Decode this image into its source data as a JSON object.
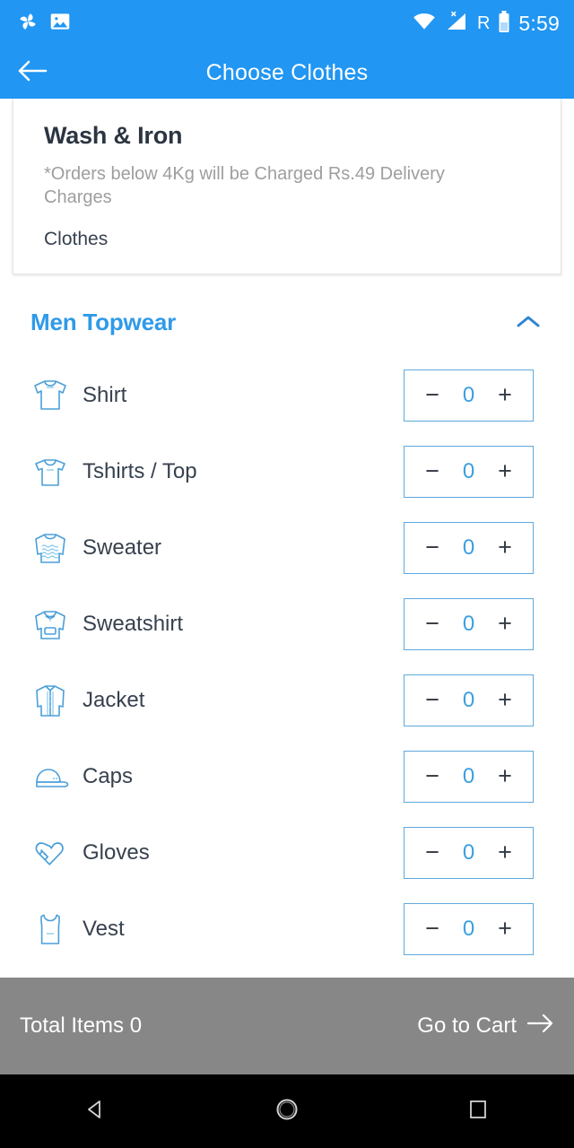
{
  "statusbar": {
    "notif_icons": [
      "photos-pinwheel-icon",
      "gallery-image-icon"
    ],
    "wifi_icon": "wifi-icon",
    "signal_icon": "cell-signal-no-sim-icon",
    "roaming_label": "R",
    "battery_icon": "battery-icon",
    "time": "5:59",
    "background": "#2196f3"
  },
  "appbar": {
    "back_icon": "arrow-left-icon",
    "title": "Choose Clothes",
    "background": "#2196f3"
  },
  "info_card": {
    "title": "Wash & Iron",
    "note": "*Orders below 4Kg will be Charged Rs.49 Delivery Charges",
    "subtitle": "Clothes"
  },
  "section": {
    "title": "Men Topwear",
    "title_color": "#2f9ae8",
    "collapse_icon": "chevron-up-icon",
    "expanded": true
  },
  "stepper": {
    "minus_label": "−",
    "plus_label": "+",
    "border_color": "#5fa9dd",
    "value_color": "#3b9fe0"
  },
  "items": [
    {
      "label": "Shirt",
      "icon": "shirt-icon",
      "qty": "0"
    },
    {
      "label": "Tshirts / Top",
      "icon": "tshirt-icon",
      "qty": "0"
    },
    {
      "label": "Sweater",
      "icon": "sweater-icon",
      "qty": "0"
    },
    {
      "label": "Sweatshirt",
      "icon": "sweatshirt-icon",
      "qty": "0"
    },
    {
      "label": "Jacket",
      "icon": "jacket-icon",
      "qty": "0"
    },
    {
      "label": "Caps",
      "icon": "cap-icon",
      "qty": "0"
    },
    {
      "label": "Gloves",
      "icon": "gloves-icon",
      "qty": "0"
    },
    {
      "label": "Vest",
      "icon": "vest-icon",
      "qty": "0"
    }
  ],
  "bottombar": {
    "total_label": "Total Items 0",
    "cart_label": "Go to Cart",
    "cart_arrow_icon": "arrow-right-icon",
    "background": "#878787"
  },
  "navbar": {
    "back_icon": "nav-back-triangle-icon",
    "home_icon": "nav-home-circle-icon",
    "recents_icon": "nav-recents-square-icon"
  }
}
